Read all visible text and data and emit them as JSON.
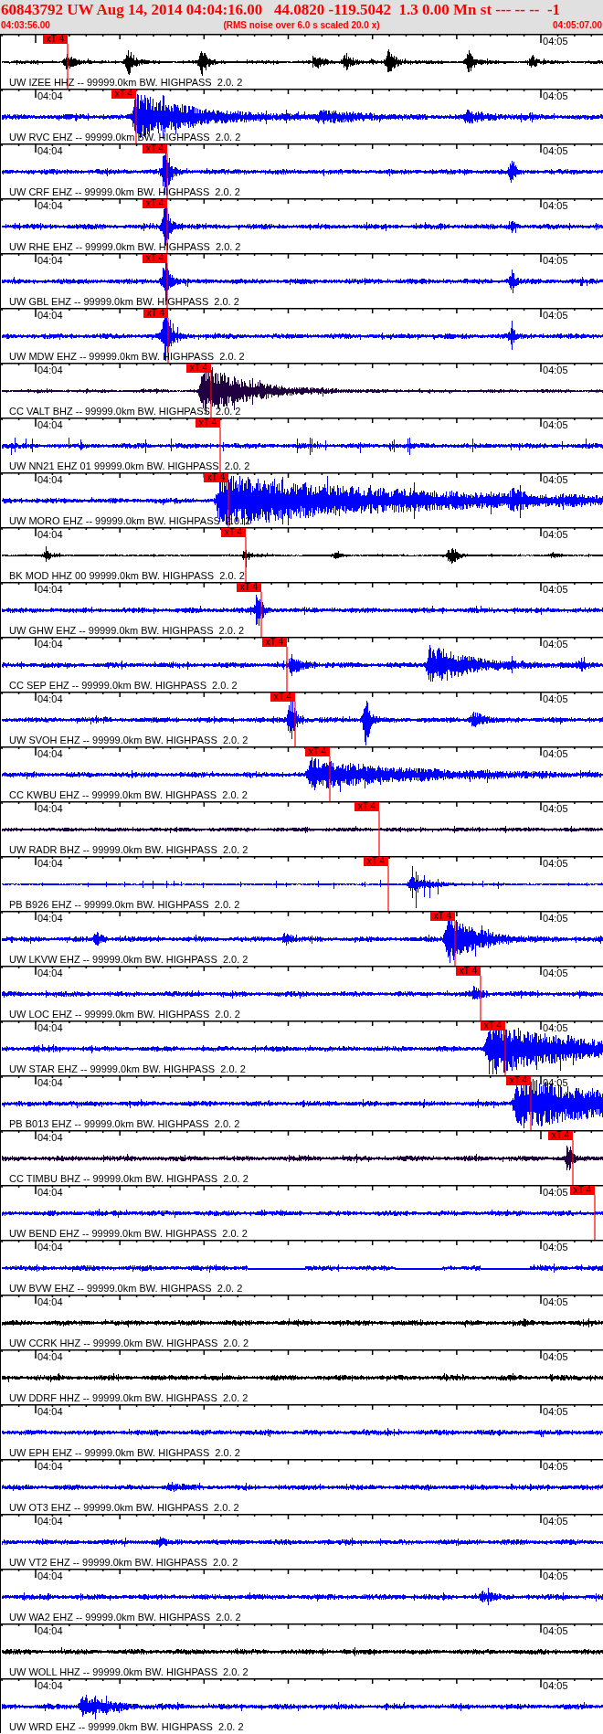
{
  "header": {
    "title": "60843792 UW Aug 14, 2014 04:04:16.00   44.0820 -119.5042  1.3 0.00 Mn st --- -- --  -1",
    "start_time": "04:03:56.00",
    "note": "(RMS noise over 6.0 s scaled 20.0 x)",
    "end_time": "04:05:07.00"
  },
  "traces": [
    {
      "station": "UW IZEE HHZ -- 99999.0km BW. HIGHPASS  2.0. 2",
      "color": "#000000",
      "end_label": "04:05",
      "pick": "xT 4"
    },
    {
      "station": "UW RVC EHZ -- 99999.0km BW. HIGHPASS  2.0. 2",
      "color": "#0000ff",
      "start_label": "04:04",
      "end_label": "04:05",
      "pick": "xT 4"
    },
    {
      "station": "UW CRF EHZ -- 99999.0km BW. HIGHPASS  2.0. 2",
      "color": "#0000ff",
      "start_label": "04:04",
      "end_label": "04:05",
      "pick": "xT 4"
    },
    {
      "station": "UW RHE EHZ -- 99999.0km BW. HIGHPASS  2.0. 2",
      "color": "#0000ff",
      "start_label": "04:04",
      "end_label": "04:05",
      "pick": "xT 4"
    },
    {
      "station": "UW GBL EHZ -- 99999.0km BW. HIGHPASS  2.0. 2",
      "color": "#0000ff",
      "start_label": "04:04",
      "end_label": "04:05",
      "pick": "xT 4"
    },
    {
      "station": "UW MDW EHZ -- 99999.0km BW. HIGHPASS  2.0. 2",
      "color": "#0000ff",
      "start_label": "04:04",
      "end_label": "04:05",
      "pick": "xT 4"
    },
    {
      "station": "CC VALT BHZ -- 99999.0km BW. HIGHPASS  2.0. 2",
      "color": "#200040",
      "start_label": "04:04",
      "end_label": "04:05",
      "pick": "xT 4"
    },
    {
      "station": "UW NN21 EHZ 01 99999.0km BW. HIGHPASS  2.0. 2",
      "color": "#0000ff",
      "start_label": "04:04",
      "end_label": "04:05",
      "pick": "xT 4"
    },
    {
      "station": "UW MORO EHZ -- 99999.0km BW. HIGHPASS  2.0. 2",
      "color": "#0000ff",
      "start_label": "04:04",
      "end_label": "04:05",
      "pick": "xT 4"
    },
    {
      "station": "BK MOD HHZ 00 99999.0km BW. HIGHPASS  2.0. 2",
      "color": "#000000",
      "start_label": "04:04",
      "end_label": "04:05",
      "pick": "xT 4"
    },
    {
      "station": "UW GHW EHZ -- 99999.0km BW. HIGHPASS  2.0. 2",
      "color": "#0000ff",
      "start_label": "04:04",
      "end_label": "04:05",
      "pick": "xT 4"
    },
    {
      "station": "CC SEP EHZ -- 99999.0km BW. HIGHPASS  2.0. 2",
      "color": "#0000ff",
      "start_label": "04:04",
      "end_label": "04:05",
      "pick": "xT 4"
    },
    {
      "station": "UW SVOH EHZ -- 99999.0km BW. HIGHPASS  2.0. 2",
      "color": "#0000ff",
      "start_label": "04:04",
      "end_label": "04:05",
      "pick": "xT 4"
    },
    {
      "station": "CC KWBU EHZ -- 99999.0km BW. HIGHPASS  2.0. 2",
      "color": "#0000ff",
      "start_label": "04:04",
      "end_label": "04:05",
      "pick": "xT 4"
    },
    {
      "station": "UW RADR BHZ -- 99999.0km BW. HIGHPASS  2.0. 2",
      "color": "#200040",
      "start_label": "04:04",
      "end_label": "04:05",
      "pick": "xT 4"
    },
    {
      "station": "PB B926 EHZ -- 99999.0km BW. HIGHPASS  2.0. 2",
      "color": "#0000ff",
      "start_label": "04:04",
      "end_label": "04:05",
      "pick": "xT 4"
    },
    {
      "station": "UW LKVW EHZ -- 99999.0km BW. HIGHPASS  2.0. 2",
      "color": "#0000ff",
      "start_label": "04:04",
      "end_label": "04:05",
      "pick": "xT 4"
    },
    {
      "station": "UW LOC EHZ -- 99999.0km BW. HIGHPASS  2.0. 2",
      "color": "#0000ff",
      "start_label": "04:04",
      "end_label": "04:05",
      "pick": "xT 4"
    },
    {
      "station": "UW STAR EHZ -- 99999.0km BW. HIGHPASS  2.0. 2",
      "color": "#0000ff",
      "start_label": "04:04",
      "end_label": "04:05",
      "pick": "xT 4"
    },
    {
      "station": "PB B013 EHZ -- 99999.0km BW. HIGHPASS  2.0. 2",
      "color": "#0000ff",
      "start_label": "04:04",
      "end_label": "04:05",
      "pick": "xT 4"
    },
    {
      "station": "CC TIMBU BHZ -- 99999.0km BW. HIGHPASS  2.0. 2",
      "color": "#200040",
      "start_label": "04:04",
      "pick": "xT 4"
    },
    {
      "station": "UW BEND EHZ -- 99999.0km BW. HIGHPASS  2.0. 2",
      "color": "#0000ff",
      "start_label": "04:04",
      "end_label": "04:05",
      "pick": "xT 4"
    },
    {
      "station": "UW BVW EHZ -- 99999.0km BW. HIGHPASS  2.0. 2",
      "color": "#0000ff",
      "start_label": "04:04",
      "end_label": "04:05"
    },
    {
      "station": "UW CCRK HHZ -- 99999.0km BW. HIGHPASS  2.0. 2",
      "color": "#000000",
      "start_label": "04:04",
      "end_label": "04:05"
    },
    {
      "station": "UW DDRF HHZ -- 99999.0km BW. HIGHPASS  2.0. 2",
      "color": "#000000",
      "start_label": "04:04",
      "end_label": "04:05"
    },
    {
      "station": "UW EPH EHZ -- 99999.0km BW. HIGHPASS  2.0. 2",
      "color": "#0000ff",
      "start_label": "04:04",
      "end_label": "04:05"
    },
    {
      "station": "UW OT3 EHZ -- 99999.0km BW. HIGHPASS  2.0. 2",
      "color": "#0000ff",
      "start_label": "04:04",
      "end_label": "04:05"
    },
    {
      "station": "UW VT2 EHZ -- 99999.0km BW. HIGHPASS  2.0. 2",
      "color": "#0000ff",
      "start_label": "04:04",
      "end_label": "04:05"
    },
    {
      "station": "UW WA2 EHZ -- 99999.0km BW. HIGHPASS  2.0. 2",
      "color": "#0000ff",
      "start_label": "04:04",
      "end_label": "04:05"
    },
    {
      "station": "UW WOLL HHZ -- 99999.0km BW. HIGHPASS  2.0. 2",
      "color": "#000000",
      "start_label": "04:04",
      "end_label": "04:05"
    },
    {
      "station": "UW WRD EHZ -- 99999.0km BW. HIGHPASS  2.0. 2",
      "color": "#0000ff",
      "start_label": "04:04",
      "end_label": "04:05"
    }
  ]
}
